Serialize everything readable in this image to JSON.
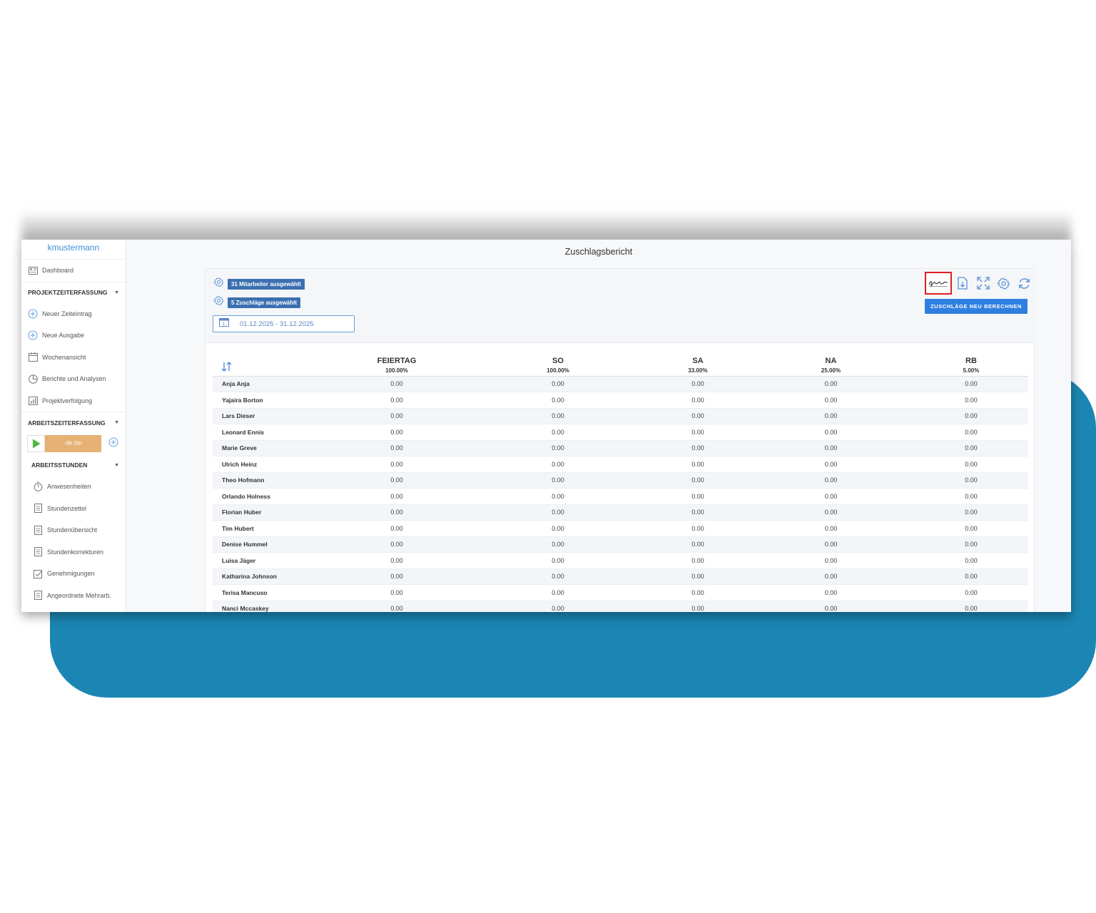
{
  "sidebar": {
    "username": "kmustermann",
    "dashboard": "Dashboard",
    "section_project": "PROJEKTZEITERFASSUNG",
    "project_items": [
      "Neuer Zeiteintrag",
      "Neue Ausgabe",
      "Wochenansicht",
      "Berichte und Analysen",
      "Projektverfolgung"
    ],
    "section_work": "ARBEITSZEITERFASSUNG",
    "timer_value": "-6h 0m",
    "section_hours": "ARBEITSSTUNDEN",
    "hours_items": [
      "Anwesenheiten",
      "Stundenzettel",
      "Stundenübersicht",
      "Stundenkorrekturen",
      "Genehmigungen",
      "Angeordnete Mehrarb."
    ]
  },
  "main": {
    "title": "Zuschlagsbericht",
    "employees_chip": "31 Mitarbeiter ausgewählt",
    "surcharges_chip": "5 Zuschläge ausgewählt",
    "date_range": "01.12.2025 - 31.12.2025",
    "recalc_button": "ZUSCHLÄGE NEU BERECHNEN"
  },
  "colors": {
    "accent": "#2f7fe0",
    "chip": "#3b6fb0",
    "timer": "#e6b172",
    "play": "#4cba3c",
    "background_shape": "#1b86b3",
    "highlight": "#e02020"
  },
  "table": {
    "columns": [
      {
        "label": "FEIERTAG",
        "pct": "100.00%"
      },
      {
        "label": "SO",
        "pct": "100.00%"
      },
      {
        "label": "SA",
        "pct": "33.00%"
      },
      {
        "label": "NA",
        "pct": "25.00%"
      },
      {
        "label": "RB",
        "pct": "5.00%"
      }
    ],
    "rows": [
      {
        "name": "Anja Anja",
        "values": [
          "0.00",
          "0.00",
          "0.00",
          "0.00",
          "0.00"
        ]
      },
      {
        "name": "Yajaira Borton",
        "values": [
          "0.00",
          "0.00",
          "0.00",
          "0.00",
          "0.00"
        ]
      },
      {
        "name": "Lars Dieser",
        "values": [
          "0.00",
          "0.00",
          "0.00",
          "0.00",
          "0.00"
        ]
      },
      {
        "name": "Leonard Ennis",
        "values": [
          "0.00",
          "0.00",
          "0.00",
          "0.00",
          "0.00"
        ]
      },
      {
        "name": "Marie Greve",
        "values": [
          "0.00",
          "0.00",
          "0.00",
          "0.00",
          "0.00"
        ]
      },
      {
        "name": "Ulrich Heinz",
        "values": [
          "0.00",
          "0.00",
          "0.00",
          "0.00",
          "0.00"
        ]
      },
      {
        "name": "Theo Hofmann",
        "values": [
          "0.00",
          "0.00",
          "0.00",
          "0.00",
          "0.00"
        ]
      },
      {
        "name": "Orlando Holness",
        "values": [
          "0.00",
          "0.00",
          "0.00",
          "0.00",
          "0.00"
        ]
      },
      {
        "name": "Florian Huber",
        "values": [
          "0.00",
          "0.00",
          "0.00",
          "0.00",
          "0.00"
        ]
      },
      {
        "name": "Tim Hubert",
        "values": [
          "0.00",
          "0.00",
          "0.00",
          "0.00",
          "0.00"
        ]
      },
      {
        "name": "Denise Hummel",
        "values": [
          "0.00",
          "0.00",
          "0.00",
          "0.00",
          "0.00"
        ]
      },
      {
        "name": "Luisa Jäger",
        "values": [
          "0.00",
          "0.00",
          "0.00",
          "0.00",
          "0.00"
        ]
      },
      {
        "name": "Katharina Johnson",
        "values": [
          "0.00",
          "0.00",
          "0.00",
          "0.00",
          "0.00"
        ]
      },
      {
        "name": "Terisa Mancuso",
        "values": [
          "0.00",
          "0.00",
          "0.00",
          "0.00",
          "0.00"
        ]
      },
      {
        "name": "Nanci Mccaskey",
        "values": [
          "0.00",
          "0.00",
          "0.00",
          "0.00",
          "0.00"
        ]
      }
    ]
  }
}
